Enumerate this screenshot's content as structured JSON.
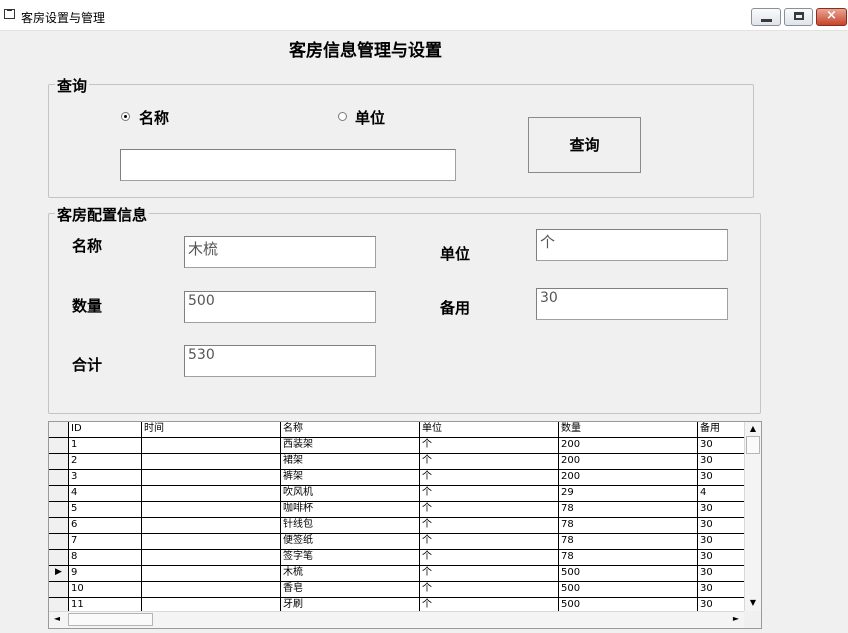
{
  "window": {
    "title": "客房设置与管理",
    "icon": "window-icon",
    "controls": {
      "minimize": "minimize-icon",
      "maximize": "maximize-icon",
      "close": "close-icon",
      "close_glyph": "×"
    }
  },
  "heading": "客房信息管理与设置",
  "search": {
    "legend": "查询",
    "options": [
      {
        "label": "名称",
        "checked": true
      },
      {
        "label": "单位",
        "checked": false
      }
    ],
    "query_value": "",
    "button_label": "查询"
  },
  "config": {
    "legend": "客房配置信息",
    "fields": {
      "name": {
        "label": "名称",
        "value": "木梳"
      },
      "unit": {
        "label": "单位",
        "value": "个"
      },
      "quantity": {
        "label": "数量",
        "value": "500"
      },
      "reserve": {
        "label": "备用",
        "value": "30"
      },
      "total": {
        "label": "合计",
        "value": "530"
      }
    }
  },
  "grid": {
    "columns": [
      "ID",
      "时间",
      "名称",
      "单位",
      "数量",
      "备用"
    ],
    "rows": [
      [
        "1",
        "",
        "西装架",
        "个",
        "200",
        "30"
      ],
      [
        "2",
        "",
        "裙架",
        "个",
        "200",
        "30"
      ],
      [
        "3",
        "",
        "裤架",
        "个",
        "200",
        "30"
      ],
      [
        "4",
        "",
        "吹风机",
        "个",
        "29",
        "4"
      ],
      [
        "5",
        "",
        "咖啡杯",
        "个",
        "78",
        "30"
      ],
      [
        "6",
        "",
        "针线包",
        "个",
        "78",
        "30"
      ],
      [
        "7",
        "",
        "便签纸",
        "个",
        "78",
        "30"
      ],
      [
        "8",
        "",
        "签字笔",
        "个",
        "78",
        "30"
      ],
      [
        "9",
        "",
        "木梳",
        "个",
        "500",
        "30"
      ],
      [
        "10",
        "",
        "香皂",
        "个",
        "500",
        "30"
      ],
      [
        "11",
        "",
        "牙刷",
        "个",
        "500",
        "30"
      ]
    ],
    "current_row_index": 8,
    "current_row_marker": "▶",
    "scroll_up": "▲",
    "scroll_down": "▼",
    "scroll_left": "◄",
    "scroll_right": "►"
  }
}
